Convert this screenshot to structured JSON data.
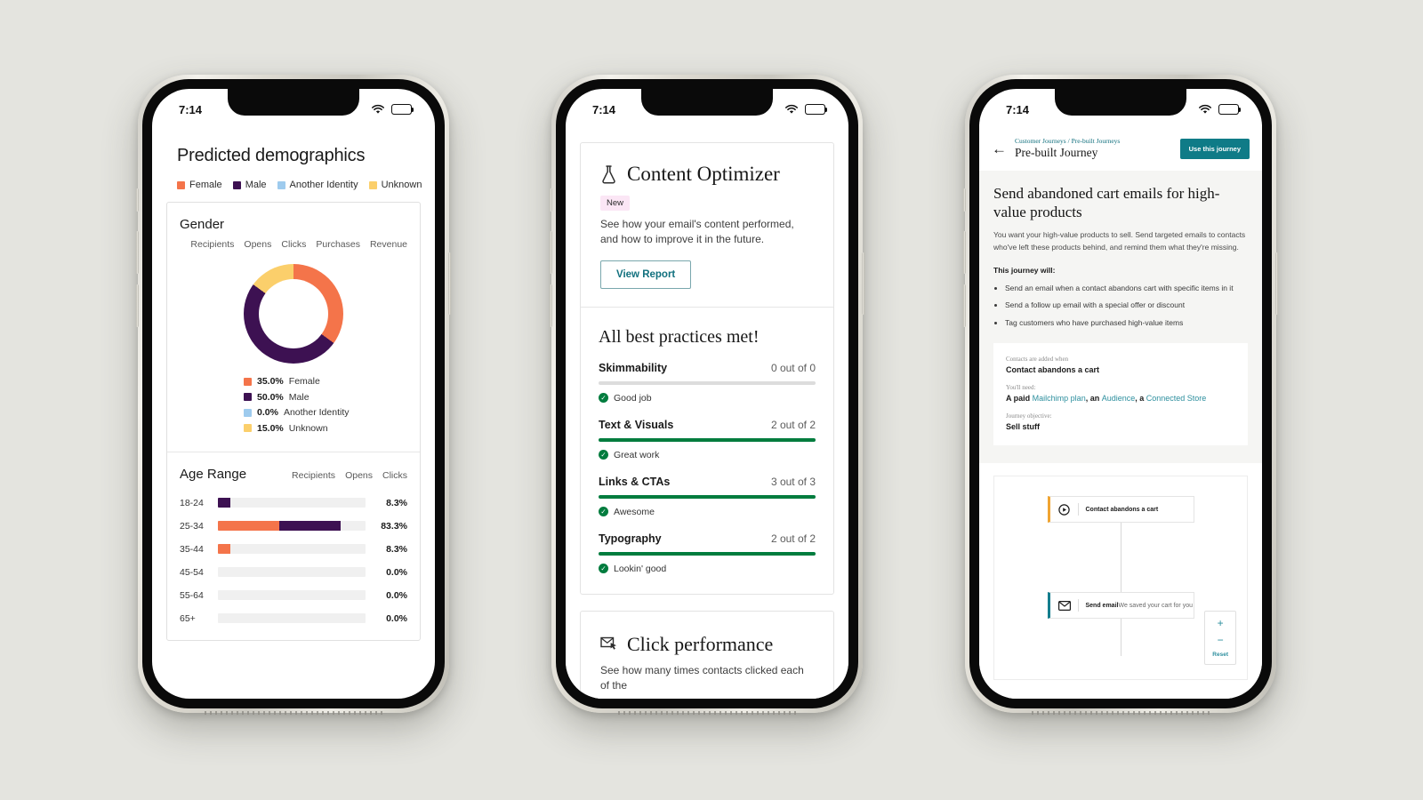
{
  "colors": {
    "female": "#f4744a",
    "male": "#3d1152",
    "another_identity": "#9ecbee",
    "unknown": "#fbcf6b",
    "green": "#007c3e",
    "teal": "#0f7b87",
    "link_teal": "#2d8f9e",
    "badge_pink": "#fbe6f5",
    "page_background": "#e4e4df"
  },
  "status_bar": {
    "time": "7:14",
    "wifi_icon": "wifi-icon",
    "battery_icon": "battery-icon"
  },
  "phone1": {
    "page_title": "Predicted demographics",
    "legend": [
      {
        "label": "Female",
        "color": "#f4744a"
      },
      {
        "label": "Male",
        "color": "#3d1152"
      },
      {
        "label": "Another Identity",
        "color": "#9ecbee"
      },
      {
        "label": "Unknown",
        "color": "#fbcf6b"
      }
    ],
    "gender": {
      "title": "Gender",
      "columns": [
        "Recipients",
        "Opens",
        "Clicks",
        "Purchases",
        "Revenue"
      ],
      "breakdown": [
        {
          "pct": "35.0%",
          "label": "Female",
          "color": "#f4744a",
          "value": 35.0
        },
        {
          "pct": "50.0%",
          "label": "Male",
          "color": "#3d1152",
          "value": 50.0
        },
        {
          "pct": "0.0%",
          "label": "Another Identity",
          "color": "#9ecbee",
          "value": 0.0
        },
        {
          "pct": "15.0%",
          "label": "Unknown",
          "color": "#fbcf6b",
          "value": 15.0
        }
      ]
    },
    "age_range": {
      "title": "Age Range",
      "columns": [
        "Recipients",
        "Opens",
        "Clicks"
      ],
      "rows": [
        {
          "label": "18-24",
          "pct": "8.3%",
          "segments": [
            {
              "color": "#3d1152",
              "width": 8.3
            }
          ]
        },
        {
          "label": "25-34",
          "pct": "83.3%",
          "segments": [
            {
              "color": "#f4744a",
              "width": 41.6
            },
            {
              "color": "#3d1152",
              "width": 41.7
            }
          ]
        },
        {
          "label": "35-44",
          "pct": "8.3%",
          "segments": [
            {
              "color": "#f4744a",
              "width": 8.3
            }
          ]
        },
        {
          "label": "45-54",
          "pct": "0.0%",
          "segments": []
        },
        {
          "label": "55-64",
          "pct": "0.0%",
          "segments": []
        },
        {
          "label": "65+",
          "pct": "0.0%",
          "segments": []
        }
      ]
    },
    "chart_data": {
      "type": "pie",
      "title": "Gender",
      "labels": [
        "Female",
        "Male",
        "Another Identity",
        "Unknown"
      ],
      "values": [
        35.0,
        50.0,
        0.0,
        15.0
      ],
      "colors": [
        "#f4744a",
        "#3d1152",
        "#9ecbee",
        "#fbcf6b"
      ],
      "unit": "%",
      "legend_position": "below",
      "secondary": {
        "type": "bar",
        "title": "Age Range",
        "orientation": "horizontal",
        "categories": [
          "18-24",
          "25-34",
          "35-44",
          "45-54",
          "55-64",
          "65+"
        ],
        "values": [
          8.3,
          83.3,
          8.3,
          0.0,
          0.0,
          0.0
        ],
        "xlim": [
          0,
          100
        ],
        "ylabel": "",
        "xlabel": "",
        "grid": false
      }
    }
  },
  "phone2": {
    "optimizer": {
      "icon": "flask-icon",
      "title": "Content Optimizer",
      "badge": "New",
      "description": "See how your email's content performed, and how to improve it in the future.",
      "button": "View Report"
    },
    "best_practices": {
      "heading": "All best practices met!",
      "items": [
        {
          "name": "Skimmability",
          "score": "0 out of 0",
          "fill": 0,
          "note": "Good job"
        },
        {
          "name": "Text & Visuals",
          "score": "2 out of 2",
          "fill": 100,
          "note": "Great work"
        },
        {
          "name": "Links & CTAs",
          "score": "3 out of 3",
          "fill": 100,
          "note": "Awesome"
        },
        {
          "name": "Typography",
          "score": "2 out of 2",
          "fill": 100,
          "note": "Lookin' good"
        }
      ]
    },
    "click_performance": {
      "icon": "click-map-icon",
      "title": "Click performance",
      "description": "See how many times contacts clicked each of the"
    }
  },
  "phone3": {
    "header": {
      "back_icon": "back-arrow-icon",
      "breadcrumb_1": "Customer Journeys",
      "breadcrumb_sep": " / ",
      "breadcrumb_2": "Pre-built Journeys",
      "title": "Pre-built Journey",
      "cta": "Use this journey"
    },
    "body": {
      "heading": "Send abandoned cart emails for high-value products",
      "paragraph": "You want your high-value products to sell. Send targeted emails to contacts who've left these products behind, and remind them what they're missing.",
      "list_label": "This journey will:",
      "bullets": [
        "Send an email when a contact abandons cart with specific items in it",
        "Send a follow up email with a special offer or discount",
        "Tag customers who have purchased high-value items"
      ]
    },
    "details": [
      {
        "label": "Contacts are added when",
        "value": "Contact abandons a cart"
      },
      {
        "label": "You'll need:",
        "value_prefix": "A paid ",
        "link1": "Mailchimp plan",
        "mid1": ", an ",
        "link2": "Audience",
        "mid2": ", a ",
        "link3": "Connected Store"
      },
      {
        "label": "Journey objective:",
        "value": "Sell stuff"
      }
    ],
    "flow": {
      "nodes": [
        {
          "icon": "play-circle-icon",
          "label": "Contact abandons a cart",
          "sub": "",
          "accent": "#f0a431"
        },
        {
          "icon": "envelope-icon",
          "label": "Send email",
          "sub": "We saved your cart for you",
          "accent": "#147d8d"
        }
      ],
      "zoom_controls": {
        "zoom_in": "+",
        "zoom_out": "−",
        "reset": "Reset"
      }
    }
  }
}
